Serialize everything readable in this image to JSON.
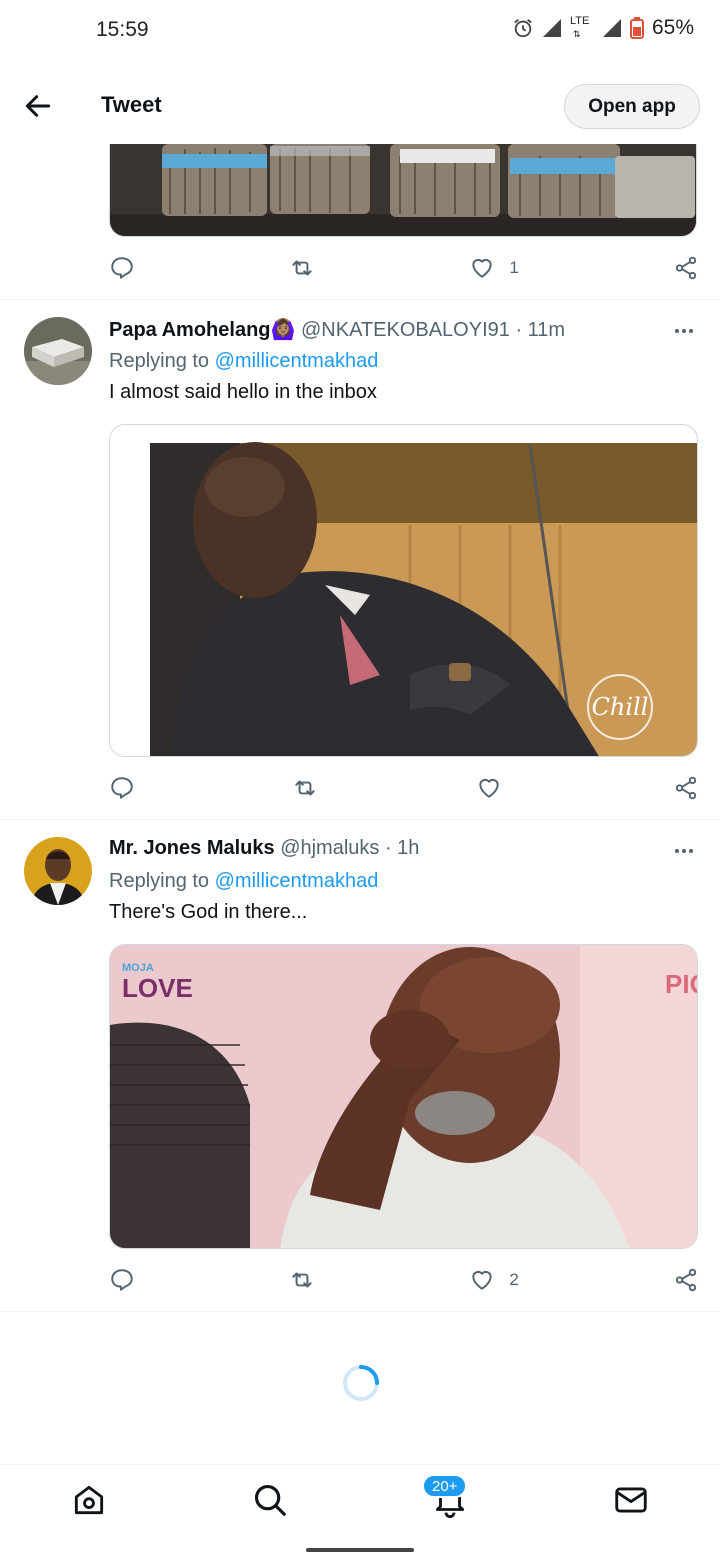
{
  "status_bar": {
    "time": "15:59",
    "network": "LTE",
    "battery": "65%",
    "icons": [
      "alarm-icon",
      "signal-icon",
      "signal-icon",
      "battery-icon"
    ]
  },
  "header": {
    "title": "Tweet",
    "open_app_label": "Open app"
  },
  "tweets": [
    {
      "image": "money-bundles-photo",
      "likes": "1"
    },
    {
      "name": "Papa Amohelang",
      "emoji": "🙆🏽‍♀️",
      "handle": "@NKATEKOBALOYI91",
      "time": "· 11m",
      "replying_prefix": "Replying to ",
      "replying_to": "@millicentmakhad",
      "text": "I almost said hello in the inbox",
      "image_watermark": "Chill",
      "likes": ""
    },
    {
      "name": "Mr. Jones Maluks",
      "handle": "@hjmaluks",
      "time": "· 1h",
      "replying_prefix": "Replying to ",
      "replying_to": "@millicentmakhad",
      "text": "There's God in there...",
      "image_logo_top": "MOJA",
      "image_logo_bottom": "LOVE",
      "image_corner_text": "PIG",
      "likes": "2"
    }
  ],
  "bottom_nav": {
    "items": [
      "home-icon",
      "search-icon",
      "notifications-icon",
      "messages-icon"
    ],
    "notification_badge": "20+"
  }
}
